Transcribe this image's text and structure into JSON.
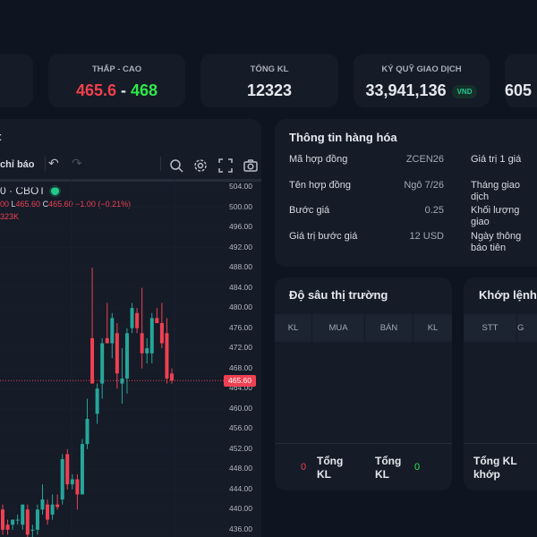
{
  "stats": [
    {
      "label": "",
      "value": ""
    },
    {
      "label": "THẤP - CAO",
      "low": "465.6",
      "sep": " - ",
      "high": "468"
    },
    {
      "label": "TỔNG KL",
      "value": "12323"
    },
    {
      "label": "KÝ QUỸ GIAO DỊCH",
      "value": "33,941,136",
      "unit": "VND"
    },
    {
      "label": "",
      "value": "605"
    }
  ],
  "chart": {
    "title": "t",
    "indicators": "chỉ báo",
    "symbol": "0 · CBOT",
    "ohlc_prefix": "00 ",
    "l_label": "L",
    "l_val": "465.60",
    "c_label": "C",
    "c_val": "465.60",
    "change": "−1.00 (−0.21%)",
    "volume": "323K",
    "last_price": "465.60",
    "axis": [
      "504.00",
      "500.00",
      "496.00",
      "492.00",
      "488.00",
      "484.00",
      "480.00",
      "476.00",
      "472.00",
      "468.00",
      "464.00",
      "460.00",
      "456.00",
      "452.00",
      "448.00",
      "444.00",
      "440.00",
      "436.00"
    ]
  },
  "chart_data": {
    "type": "candlestick",
    "ylim": [
      436,
      504
    ],
    "last": 465.6,
    "colors": {
      "up": "#26a69a",
      "down": "#ef4052"
    },
    "candles": [
      [
        440,
        441,
        435,
        436
      ],
      [
        437,
        438,
        435,
        436
      ],
      [
        437,
        438,
        436,
        438
      ],
      [
        438,
        439,
        437,
        438
      ],
      [
        437,
        441,
        436,
        441
      ],
      [
        440,
        441,
        434,
        435
      ],
      [
        436,
        437,
        434,
        436
      ],
      [
        436,
        441,
        435,
        440
      ],
      [
        440,
        445,
        439,
        442
      ],
      [
        441,
        442,
        437,
        438
      ],
      [
        439,
        443,
        438,
        441
      ],
      [
        441,
        443,
        440,
        440.5
      ],
      [
        442,
        451,
        441,
        450
      ],
      [
        451,
        452,
        444,
        445
      ],
      [
        445,
        447,
        444,
        446
      ],
      [
        446,
        447,
        440,
        443
      ],
      [
        443,
        454,
        443,
        453
      ],
      [
        453,
        462,
        452,
        458
      ],
      [
        474,
        488,
        465,
        465
      ],
      [
        459,
        465,
        457,
        464
      ],
      [
        465,
        474,
        462,
        473
      ],
      [
        474,
        481,
        473,
        473
      ],
      [
        473,
        479,
        470,
        478
      ],
      [
        475,
        477,
        464,
        467
      ],
      [
        465,
        472,
        461,
        466
      ],
      [
        466,
        476,
        463,
        475
      ],
      [
        476,
        481,
        475,
        480
      ],
      [
        479,
        480,
        475,
        476
      ],
      [
        475,
        484,
        468,
        471
      ],
      [
        471,
        474,
        469,
        472
      ],
      [
        471,
        479,
        469,
        478
      ],
      [
        478,
        480,
        477,
        477
      ],
      [
        477,
        481,
        472,
        473
      ],
      [
        475,
        478,
        465,
        466
      ],
      [
        467,
        468,
        465,
        465.6
      ]
    ]
  },
  "info": {
    "title": "Thông tin hàng hóa",
    "rows": [
      {
        "label": "Mã hợp đồng",
        "value": "ZCEN26",
        "label2": "Giá trị 1 giá"
      },
      {
        "label": "Tên hợp đồng",
        "value": "Ngô 7/26",
        "label2": "Tháng giao dịch"
      },
      {
        "label": "Bước giá",
        "value": "0.25",
        "label2": "Khối lượng giao"
      },
      {
        "label": "Giá trị bước giá",
        "value": "12 USD",
        "label2": "Ngày thông báo",
        "label2b": "tiên"
      }
    ]
  },
  "depth": {
    "title": "Độ sâu thị trường",
    "cols": [
      "KL",
      "MUA",
      "BÁN",
      "KL"
    ],
    "buy_total": "0",
    "sell_total": "0",
    "total_label": "Tổng",
    "total_label2": "KL"
  },
  "match": {
    "title": "Khớp lệnh",
    "cols": [
      "STT",
      "G"
    ],
    "total1": "Tổng KL",
    "total2": "khớp"
  }
}
